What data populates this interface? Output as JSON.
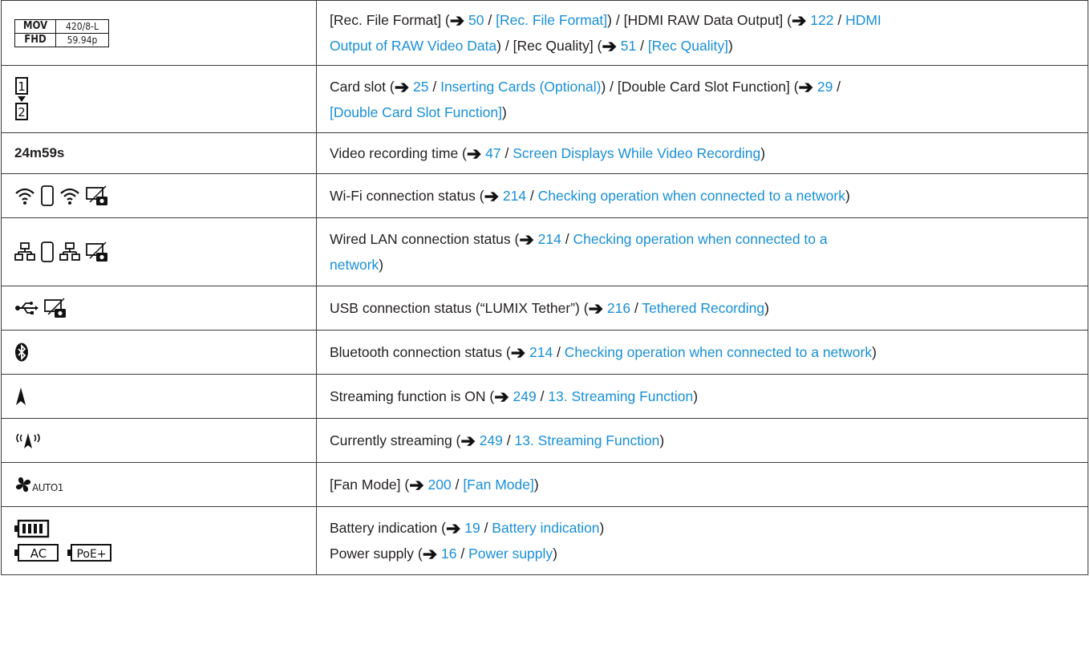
{
  "rows": [
    {
      "icon": "mov-fhd-format-icon",
      "icon_texts": [
        "MOV",
        "420/8-L",
        "FHD",
        "59.94p"
      ],
      "lines": [
        [
          {
            "t": "[Rec. File Format] ("
          },
          {
            "arrow": true
          },
          {
            "link": " 50"
          },
          {
            "t": " / "
          },
          {
            "link": "[Rec. File Format]"
          },
          {
            "t": ") / [HDMI RAW Data Output] ("
          },
          {
            "arrow": true
          },
          {
            "link": " 122"
          },
          {
            "t": " / "
          },
          {
            "link": "HDMI"
          }
        ],
        [
          {
            "link": "Output of RAW Video Data"
          },
          {
            "t": ") / [Rec Quality] ("
          },
          {
            "arrow": true
          },
          {
            "link": " 51"
          },
          {
            "t": " / "
          },
          {
            "link": "[Rec Quality]"
          },
          {
            "t": ")"
          }
        ]
      ]
    },
    {
      "icon": "card-slot-icon",
      "icon_texts": [
        "1",
        "2"
      ],
      "lines": [
        [
          {
            "t": "Card slot ("
          },
          {
            "arrow": true
          },
          {
            "link": " 25"
          },
          {
            "t": " / "
          },
          {
            "link": "Inserting Cards (Optional)"
          },
          {
            "t": ") / [Double Card Slot Function] ("
          },
          {
            "arrow": true
          },
          {
            "link": " 29"
          },
          {
            "t": " /"
          }
        ],
        [
          {
            "link": "[Double Card Slot Function]"
          },
          {
            "t": ")"
          }
        ]
      ]
    },
    {
      "icon": "recording-time-text",
      "icon_texts": [
        "24m59s"
      ],
      "lines": [
        [
          {
            "t": "Video recording time ("
          },
          {
            "arrow": true
          },
          {
            "link": " 47"
          },
          {
            "t": " / "
          },
          {
            "link": "Screen Displays While Video Recording"
          },
          {
            "t": ")"
          }
        ]
      ]
    },
    {
      "icon": "wifi-status-icons",
      "icon_texts": [],
      "lines": [
        [
          {
            "t": "Wi-Fi connection status ("
          },
          {
            "arrow": true
          },
          {
            "link": " 214"
          },
          {
            "t": " / "
          },
          {
            "link": "Checking operation when connected to a network"
          },
          {
            "t": ")"
          }
        ]
      ]
    },
    {
      "icon": "wired-lan-status-icons",
      "icon_texts": [],
      "lines": [
        [
          {
            "t": "Wired LAN connection status ("
          },
          {
            "arrow": true
          },
          {
            "link": " 214"
          },
          {
            "t": " / "
          },
          {
            "link": "Checking operation when connected to a"
          }
        ],
        [
          {
            "link": "network"
          },
          {
            "t": ")"
          }
        ]
      ]
    },
    {
      "icon": "usb-tether-icons",
      "icon_texts": [],
      "lines": [
        [
          {
            "t": "USB connection status (“LUMIX Tether”) ("
          },
          {
            "arrow": true
          },
          {
            "link": " 216"
          },
          {
            "t": " / "
          },
          {
            "link": "Tethered Recording"
          },
          {
            "t": ")"
          }
        ]
      ]
    },
    {
      "icon": "bluetooth-icon",
      "icon_texts": [],
      "lines": [
        [
          {
            "t": "Bluetooth connection status ("
          },
          {
            "arrow": true
          },
          {
            "link": " 214"
          },
          {
            "t": " / "
          },
          {
            "link": "Checking operation when connected to a network"
          },
          {
            "t": ")"
          }
        ]
      ]
    },
    {
      "icon": "streaming-on-icon",
      "icon_texts": [],
      "lines": [
        [
          {
            "t": "Streaming function is ON ("
          },
          {
            "arrow": true
          },
          {
            "link": " 249"
          },
          {
            "t": " / "
          },
          {
            "link": "13.  Streaming Function"
          },
          {
            "t": ")"
          }
        ]
      ]
    },
    {
      "icon": "currently-streaming-icon",
      "icon_texts": [],
      "lines": [
        [
          {
            "t": "Currently streaming ("
          },
          {
            "arrow": true
          },
          {
            "link": " 249"
          },
          {
            "t": " / "
          },
          {
            "link": "13.  Streaming Function"
          },
          {
            "t": ")"
          }
        ]
      ]
    },
    {
      "icon": "fan-mode-icon",
      "icon_texts": [
        "AUTO1"
      ],
      "lines": [
        [
          {
            "t": "[Fan Mode] ("
          },
          {
            "arrow": true
          },
          {
            "link": " 200"
          },
          {
            "t": " / "
          },
          {
            "link": "[Fan Mode]"
          },
          {
            "t": ")"
          }
        ]
      ]
    },
    {
      "icon": "battery-power-icons",
      "icon_texts": [
        "AC",
        "PoE+"
      ],
      "lines": [
        [
          {
            "t": "Battery indication ("
          },
          {
            "arrow": true
          },
          {
            "link": " 19"
          },
          {
            "t": " / "
          },
          {
            "link": "Battery indication"
          },
          {
            "t": ")"
          }
        ],
        [
          {
            "t": "Power supply ("
          },
          {
            "arrow": true
          },
          {
            "link": " 16"
          },
          {
            "t": " / "
          },
          {
            "link": "Power supply"
          },
          {
            "t": ")"
          }
        ]
      ]
    }
  ]
}
